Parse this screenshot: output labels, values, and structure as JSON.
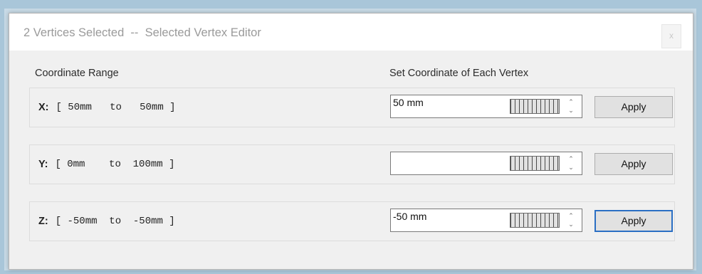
{
  "window": {
    "title": "2 Vertices Selected  --  Selected Vertex Editor",
    "close_label": "x"
  },
  "headers": {
    "left": "Coordinate Range",
    "right": "Set Coordinate of Each Vertex"
  },
  "rows": [
    {
      "axis": "X:",
      "range": "[ 50mm   to   50mm ]",
      "value": "50 mm",
      "apply_label": "Apply"
    },
    {
      "axis": "Y:",
      "range": "[ 0mm    to  100mm ]",
      "value": "",
      "apply_label": "Apply"
    },
    {
      "axis": "Z:",
      "range": "[ -50mm  to  -50mm ]",
      "value": "-50 mm",
      "apply_label": "Apply"
    }
  ],
  "icons": {
    "spin": "up-down-spinner-icon",
    "slider": "ruler-slider-icon"
  },
  "colors": {
    "focus_border": "#2b6fc4",
    "background": "#a9c6d9"
  }
}
